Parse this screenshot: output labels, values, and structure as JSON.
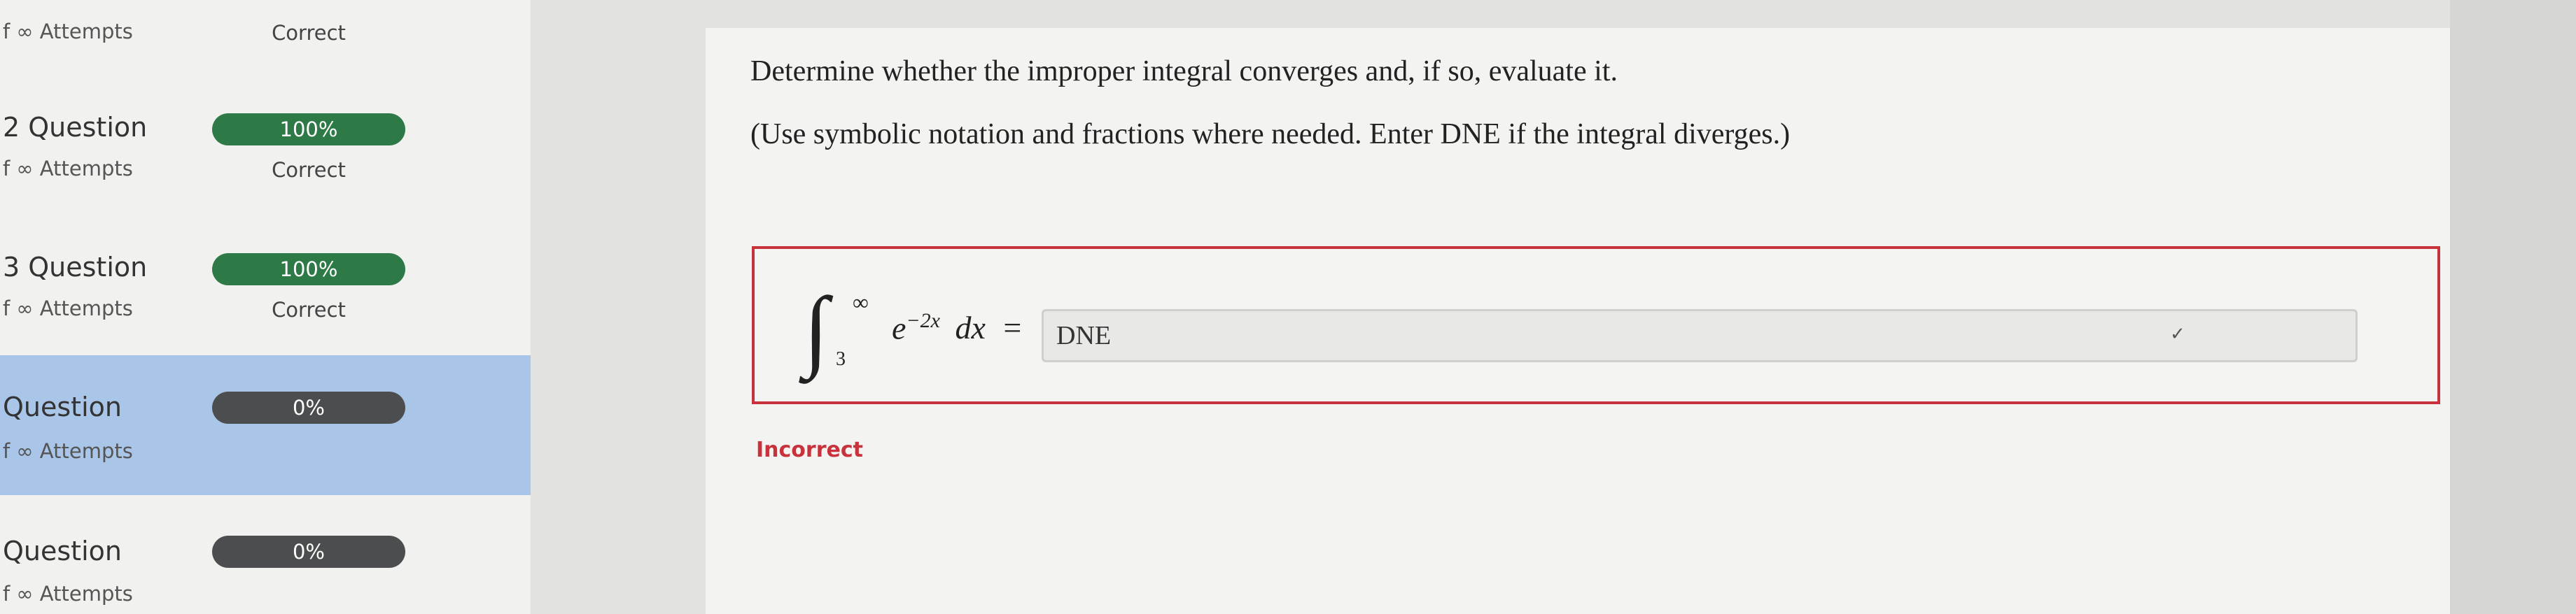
{
  "sidebar": {
    "items": [
      {
        "title": "",
        "attempts": "f ∞ Attempts",
        "score": "",
        "status": "Correct"
      },
      {
        "title": "2 Question",
        "attempts": "f ∞ Attempts",
        "score": "100%",
        "status": "Correct"
      },
      {
        "title": "3 Question",
        "attempts": "f ∞ Attempts",
        "score": "100%",
        "status": "Correct"
      },
      {
        "title": "Question",
        "attempts": "f ∞ Attempts",
        "score": "0%",
        "status": ""
      },
      {
        "title": "Question",
        "attempts": "f ∞ Attempts",
        "score": "0%",
        "status": ""
      }
    ]
  },
  "question": {
    "prompt": "Determine whether the improper integral converges and, if so, evaluate it.",
    "note": "(Use symbolic notation and fractions where needed. Enter DNE if the integral diverges.)",
    "integral": {
      "upper": "∞",
      "lower": "3",
      "base": "e",
      "exponent": "−2x",
      "differential": "dx",
      "equals": "="
    },
    "answer_value": "DNE",
    "feedback": "Incorrect"
  },
  "colors": {
    "correct_green": "#2e7a46",
    "pill_dark": "#4b4d4e",
    "active_item": "#a9c6e8",
    "error_red": "#c8323c"
  }
}
